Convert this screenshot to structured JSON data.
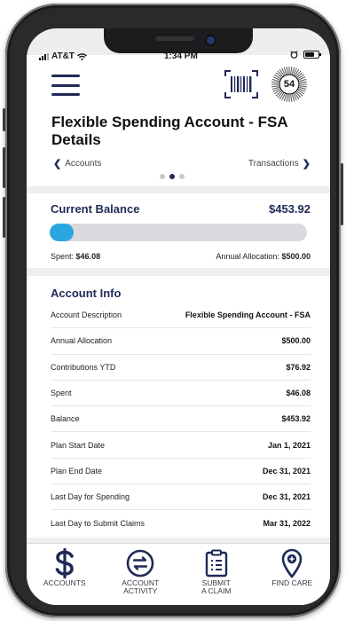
{
  "status_bar": {
    "carrier": "AT&T",
    "time": "1:34 PM"
  },
  "header": {
    "badge_count": "54",
    "title": "Flexible Spending Account - FSA Details",
    "nav_prev": "Accounts",
    "nav_next": "Transactions",
    "page_dots": 3,
    "active_dot": 1
  },
  "balance": {
    "label": "Current Balance",
    "amount": "$453.92",
    "progress_fraction": 0.0922,
    "spent_label": "Spent:",
    "spent_value": "$46.08",
    "allocation_label": "Annual Allocation:",
    "allocation_value": "$500.00"
  },
  "account_info": {
    "title": "Account Info",
    "rows": [
      {
        "label": "Account Description",
        "value": "Flexible Spending Account - FSA"
      },
      {
        "label": "Annual Allocation",
        "value": "$500.00"
      },
      {
        "label": "Contributions YTD",
        "value": "$76.92"
      },
      {
        "label": "Spent",
        "value": "$46.08"
      },
      {
        "label": "Balance",
        "value": "$453.92"
      },
      {
        "label": "Plan Start Date",
        "value": "Jan 1, 2021"
      },
      {
        "label": "Plan End Date",
        "value": "Dec 31, 2021"
      },
      {
        "label": "Last Day for Spending",
        "value": "Dec 31, 2021"
      },
      {
        "label": "Last Day to Submit Claims",
        "value": "Mar 31, 2022"
      }
    ]
  },
  "tabbar": {
    "items": [
      {
        "label": "ACCOUNTS",
        "icon": "dollar-icon"
      },
      {
        "label": "ACCOUNT\nACTIVITY",
        "icon": "exchange-icon"
      },
      {
        "label": "SUBMIT\nA CLAIM",
        "icon": "clipboard-icon"
      },
      {
        "label": "FIND CARE",
        "icon": "map-pin-plus-icon"
      }
    ]
  },
  "colors": {
    "navy": "#1f2a55",
    "progress": "#2aa6e0",
    "track": "#dadade"
  }
}
